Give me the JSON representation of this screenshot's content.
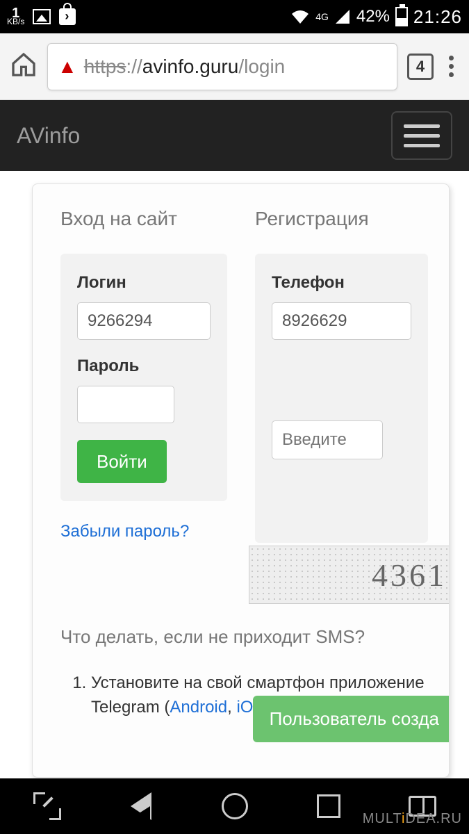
{
  "status": {
    "kbps_value": "1",
    "kbps_unit": "KB/s",
    "net_label": "4G",
    "battery_pct": "42%",
    "clock": "21:26"
  },
  "browser": {
    "url_scheme": "https",
    "url_sep": "://",
    "url_host": "avinfo.guru",
    "url_path": "/login",
    "tab_count": "4"
  },
  "nav": {
    "title": "AVinfo"
  },
  "login": {
    "heading": "Вход на сайт",
    "login_label": "Логин",
    "login_value": "9266294",
    "password_label": "Пароль",
    "password_value": "",
    "submit": "Войти",
    "forgot": "Забыли пароль?"
  },
  "register": {
    "heading": "Регистрация",
    "phone_label": "Телефон",
    "phone_value": "8926629",
    "captcha_text": "4361",
    "captcha_placeholder": "Введите",
    "toast": "Пользователь созда"
  },
  "help": {
    "question": "Что делать, если не приходит SMS?",
    "step1_a": "Установите на свой смартфон приложение Telegram (",
    "step1_android": "Android",
    "step1_sep": ", ",
    "step1_ios": "iOS",
    "step1_b": ")"
  },
  "watermark": {
    "a": "MULT",
    "b": "i",
    "c": "DEA",
    "d": ".RU"
  }
}
